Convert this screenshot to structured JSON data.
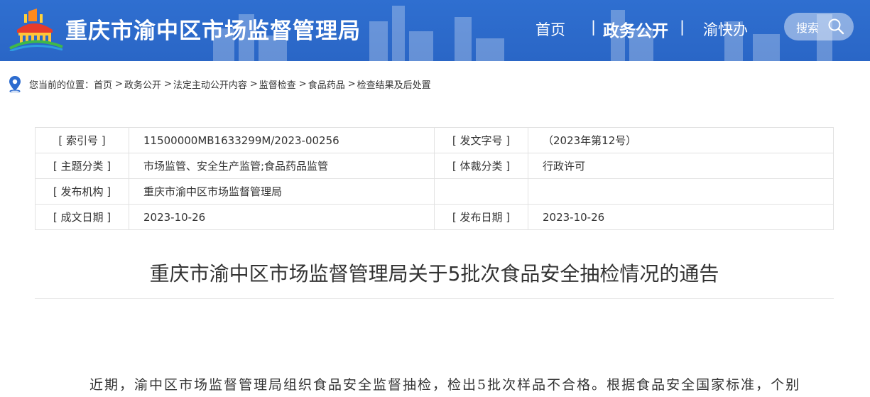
{
  "header": {
    "site_title": "重庆市渝中区市场监督管理局",
    "nav": {
      "home": "首页",
      "gov_open": "政务公开",
      "quick_service": "渝快办",
      "separator": "|"
    },
    "search_label": "搜索",
    "bg_color": "#2f6fd0"
  },
  "breadcrumb": {
    "prefix": "您当前的位置：",
    "items": [
      "首页",
      "政务公开",
      "法定主动公开内容",
      "监督检查",
      "食品药品",
      "检查结果及后处置"
    ],
    "separator": ">"
  },
  "info": {
    "index_label": "[ 索引号 ]",
    "index_value": "11500000MB1633299M/2023-00256",
    "doc_no_label": "[ 发文字号 ]",
    "doc_no_value": "（2023年第12号）",
    "topic_label": "[ 主题分类 ]",
    "topic_value": "市场监管、安全生产监管;食品药品监管",
    "genre_label": "[ 体裁分类 ]",
    "genre_value": "行政许可",
    "issuer_label": "[ 发布机构 ]",
    "issuer_value": "重庆市渝中区市场监督管理局",
    "written_label": "[ 成文日期 ]",
    "written_value": "2023-10-26",
    "publish_label": "[ 发布日期 ]",
    "publish_value": "2023-10-26"
  },
  "article": {
    "title": "重庆市渝中区市场监督管理局关于5批次食品安全抽检情况的通告",
    "body_first_line": "近期，渝中区市场监督管理局组织食品安全监督抽检，检出5批次样品不合格。根据食品安全国家标准，个别"
  }
}
